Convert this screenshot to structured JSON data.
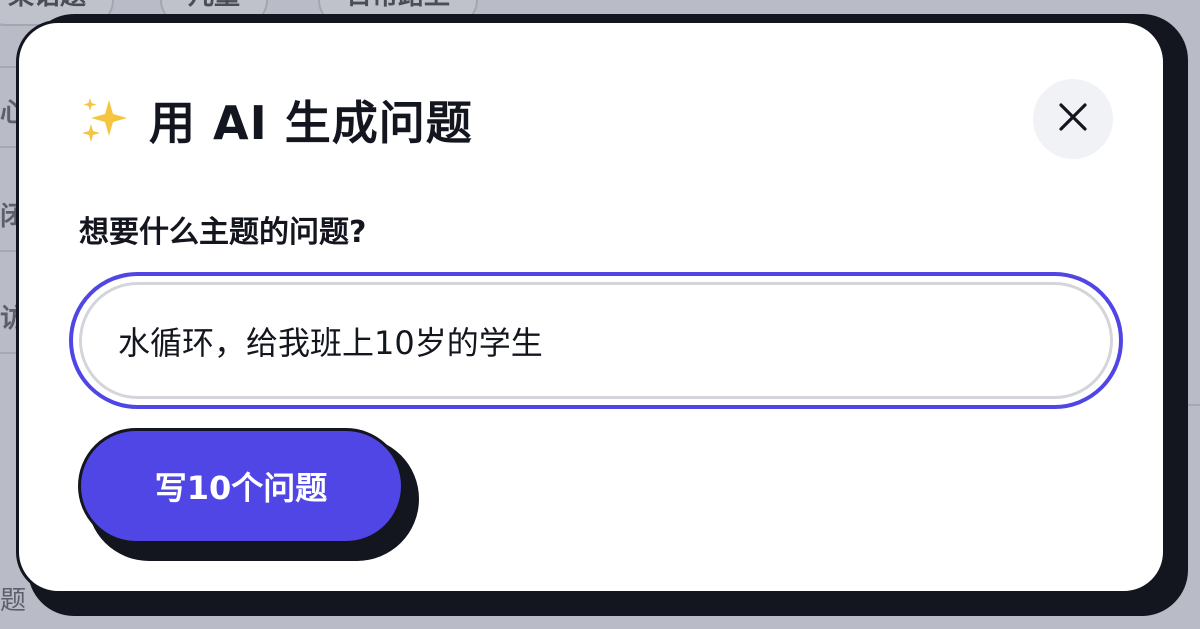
{
  "background": {
    "chips": [
      "某话题",
      "儿童",
      "日常路上"
    ],
    "side_text": [
      "心",
      "闭",
      "访",
      "题"
    ]
  },
  "modal": {
    "title_icon": "sparkles-icon",
    "title": "用 AI 生成问题",
    "close_icon": "close-icon",
    "field_label": "想要什么主题的问题?",
    "topic_input": {
      "value": "水循环，给我班上10岁的学生",
      "placeholder": ""
    },
    "generate_button": "写10个问题"
  },
  "colors": {
    "accent": "#4f46e5",
    "ink": "#14161f",
    "sparkle": "#f5c542",
    "close_bg": "#f1f2f5"
  }
}
